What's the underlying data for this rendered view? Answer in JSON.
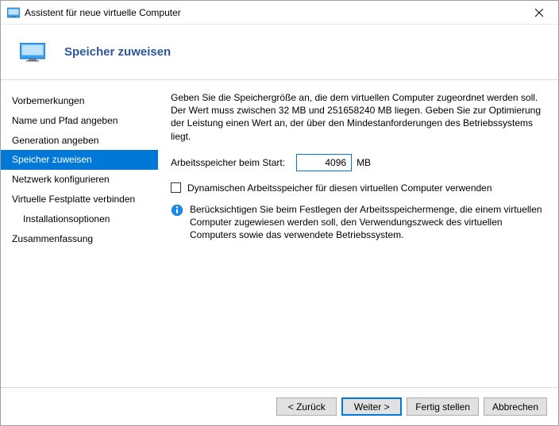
{
  "window": {
    "title": "Assistent für neue virtuelle Computer"
  },
  "header": {
    "title": "Speicher zuweisen"
  },
  "sidebar": {
    "steps": [
      {
        "label": "Vorbemerkungen",
        "active": false,
        "indent": false
      },
      {
        "label": "Name und Pfad angeben",
        "active": false,
        "indent": false
      },
      {
        "label": "Generation angeben",
        "active": false,
        "indent": false
      },
      {
        "label": "Speicher zuweisen",
        "active": true,
        "indent": false
      },
      {
        "label": "Netzwerk konfigurieren",
        "active": false,
        "indent": false
      },
      {
        "label": "Virtuelle Festplatte verbinden",
        "active": false,
        "indent": false
      },
      {
        "label": "Installationsoptionen",
        "active": false,
        "indent": true
      },
      {
        "label": "Zusammenfassung",
        "active": false,
        "indent": false
      }
    ]
  },
  "main": {
    "description": "Geben Sie die Speichergröße an, die dem virtuellen Computer zugeordnet werden soll. Der Wert muss zwischen 32 MB und 251658240 MB liegen. Geben Sie zur Optimierung der Leistung einen Wert an, der über den Mindestanforderungen des Betriebssystems liegt.",
    "memory_label": "Arbeitsspeicher beim Start:",
    "memory_value": "4096",
    "memory_unit": "MB",
    "dynamic_checkbox_label": "Dynamischen Arbeitsspeicher für diesen virtuellen Computer verwenden",
    "dynamic_checkbox_checked": false,
    "info_text": "Berücksichtigen Sie beim Festlegen der Arbeitsspeichermenge, die einem virtuellen Computer zugewiesen werden soll, den Verwendungszweck des virtuellen Computers sowie das verwendete Betriebssystem."
  },
  "footer": {
    "back": "< Zurück",
    "next": "Weiter >",
    "finish": "Fertig stellen",
    "cancel": "Abbrechen"
  },
  "colors": {
    "accent": "#0078d7",
    "header_text": "#2b579a"
  }
}
